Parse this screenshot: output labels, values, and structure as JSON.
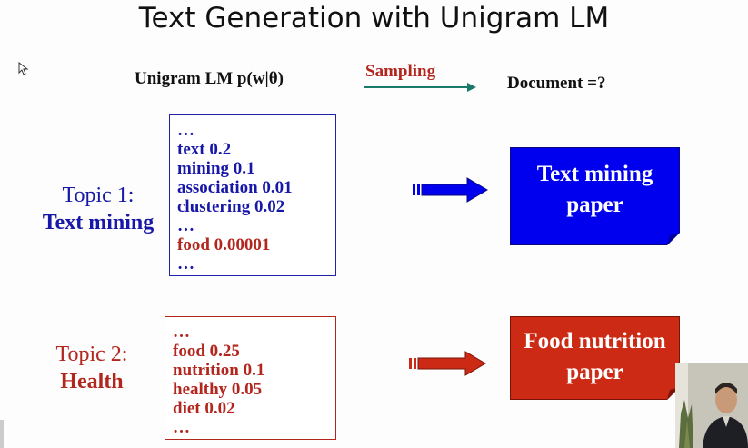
{
  "title": "Text Generation with Unigram LM",
  "header": {
    "model_label": "Unigram LM  p(w|θ)",
    "sampling_label": "Sampling",
    "document_label": "Document =?"
  },
  "topic1": {
    "label": "Topic 1:",
    "name": "Text mining",
    "words": [
      "…",
      "text  0.2",
      "mining 0.1",
      "association 0.01",
      "clustering 0.02",
      "…",
      "food 0.00001",
      "…"
    ],
    "document": [
      "Text mining",
      "paper"
    ]
  },
  "topic2": {
    "label": "Topic 2:",
    "name": "Health",
    "words": [
      "…",
      "food 0.25",
      "nutrition 0.1",
      "healthy 0.05",
      "diet 0.02",
      "…"
    ],
    "document": [
      "Food nutrition",
      "paper"
    ]
  },
  "colors": {
    "topic1": "#1818a8",
    "topic2": "#b3261e",
    "doc1_fill": "#0000ee",
    "doc2_fill": "#cc2a14",
    "sampling_arrow": "#1a7a6a"
  }
}
